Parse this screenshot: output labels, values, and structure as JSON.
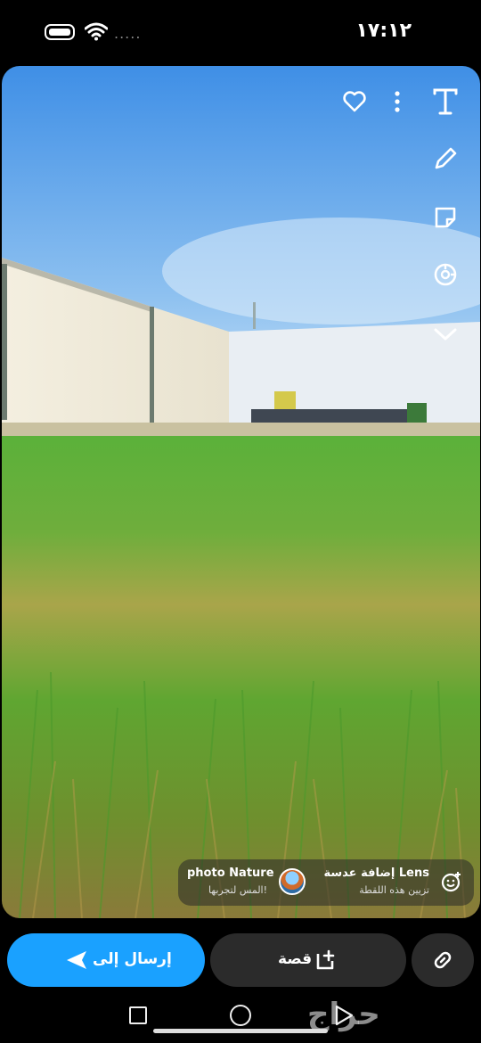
{
  "status_bar": {
    "time": "١٧:١٢",
    "signal_dots": "....."
  },
  "editor_tools": [
    "heart-icon",
    "more-icon",
    "text-icon",
    "pencil-icon",
    "sticker-icon",
    "scissors-icon",
    "chevron-down-icon"
  ],
  "lens_chip": {
    "lens_title": "إضافة عدسة Lens",
    "lens_subtitle": "تزيين هذه اللقطة",
    "nature_title": "photo Nature",
    "nature_subtitle": "المس لتجربها!"
  },
  "actions": {
    "send_label": "إرسال إلى",
    "story_label": "قصة"
  },
  "watermark": "حراج",
  "colors": {
    "send": "#1aa1ff",
    "dark_button": "#2b2b2b"
  }
}
